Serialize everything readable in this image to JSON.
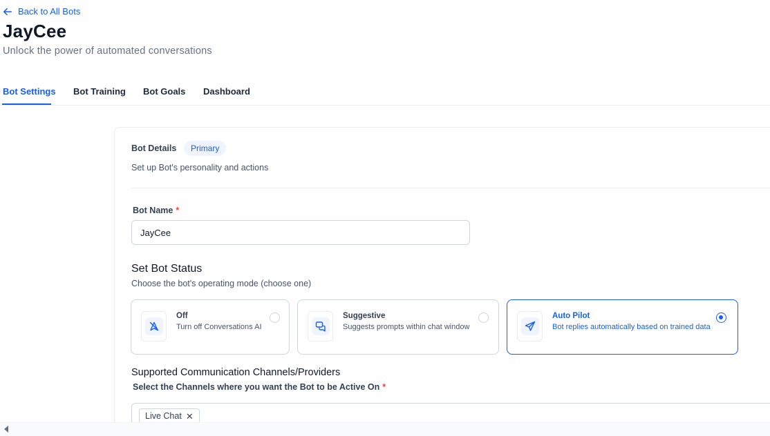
{
  "header": {
    "back_label": "Back to All Bots",
    "title": "JayCee",
    "subtitle": "Unlock the power of automated conversations"
  },
  "tabs": [
    {
      "label": "Bot Settings",
      "active": true
    },
    {
      "label": "Bot Training",
      "active": false
    },
    {
      "label": "Bot Goals",
      "active": false
    },
    {
      "label": "Dashboard",
      "active": false
    }
  ],
  "bot_details": {
    "title": "Bot Details",
    "badge": "Primary",
    "description": "Set up Bot's personality and actions"
  },
  "bot_name": {
    "label": "Bot Name",
    "required_mark": "*",
    "value": "JayCee"
  },
  "bot_status": {
    "title": "Set Bot Status",
    "description": "Choose the bot's operating mode (choose one)",
    "options": [
      {
        "name": "Off",
        "description": "Turn off Conversations AI",
        "icon": "ai-off-icon",
        "selected": false
      },
      {
        "name": "Suggestive",
        "description": "Suggests prompts within chat window",
        "icon": "chat-bubbles-icon",
        "selected": false
      },
      {
        "name": "Auto Pilot",
        "description": "Bot replies automatically based on trained data",
        "icon": "send-icon",
        "selected": true
      }
    ]
  },
  "channels": {
    "title": "Supported Communication Channels/Providers",
    "label": "Select the Channels where you want the Bot to be Active On",
    "required_mark": "*",
    "selected": [
      "Live Chat"
    ],
    "remove_glyph": "✕"
  },
  "colors": {
    "accent": "#155eef",
    "accent_light": "#eff4ff",
    "required": "#f04438",
    "border": "#d0d5dd"
  }
}
